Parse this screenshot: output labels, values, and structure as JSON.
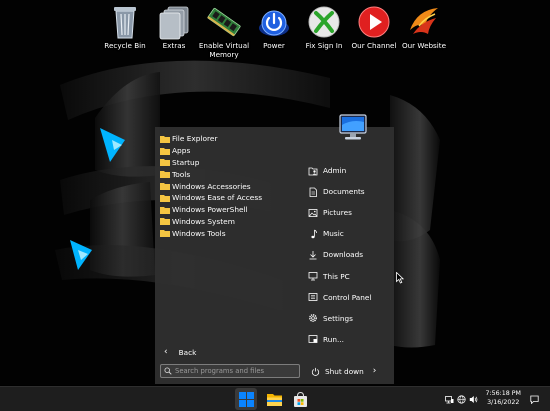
{
  "desktop_icons": [
    {
      "label": "Recycle Bin",
      "icon": "recycle-bin-icon"
    },
    {
      "label": "Extras",
      "icon": "extras-icon"
    },
    {
      "label": "Enable Virtual Memory",
      "icon": "memory-module-icon"
    },
    {
      "label": "Power",
      "icon": "power-icon"
    },
    {
      "label": "Fix Sign In",
      "icon": "xbox-icon"
    },
    {
      "label": "Our Channel",
      "icon": "play-channel-icon"
    },
    {
      "label": "Our Website",
      "icon": "website-logo-icon"
    }
  ],
  "start_menu": {
    "folders": [
      {
        "label": "File Explorer",
        "icon": "folder-icon"
      },
      {
        "label": "Apps",
        "icon": "folder-icon"
      },
      {
        "label": "Startup",
        "icon": "folder-icon"
      },
      {
        "label": "Tools",
        "icon": "folder-icon"
      },
      {
        "label": "Windows Accessories",
        "icon": "folder-icon"
      },
      {
        "label": "Windows Ease of Access",
        "icon": "folder-icon"
      },
      {
        "label": "Windows PowerShell",
        "icon": "folder-icon"
      },
      {
        "label": "Windows System",
        "icon": "folder-icon"
      },
      {
        "label": "Windows Tools",
        "icon": "folder-icon"
      }
    ],
    "user_picture_icon": "monitor-icon",
    "right_items": [
      {
        "label": "Admin",
        "icon": "user-folder-icon"
      },
      {
        "label": "Documents",
        "icon": "document-icon"
      },
      {
        "label": "Pictures",
        "icon": "picture-icon"
      },
      {
        "label": "Music",
        "icon": "music-icon"
      },
      {
        "label": "Downloads",
        "icon": "download-icon"
      },
      {
        "label": "This PC",
        "icon": "computer-icon"
      },
      {
        "label": "Control Panel",
        "icon": "control-panel-icon"
      },
      {
        "label": "Settings",
        "icon": "gear-icon"
      },
      {
        "label": "Run...",
        "icon": "run-icon"
      }
    ],
    "back_label": "Back",
    "search_placeholder": "Search programs and files",
    "shutdown_label": "Shut down"
  },
  "taskbar": {
    "buttons": [
      {
        "name": "start",
        "icon": "windows-logo-icon",
        "active": true
      },
      {
        "name": "file-explorer",
        "icon": "folder-icon"
      },
      {
        "name": "store",
        "icon": "store-bag-icon"
      }
    ],
    "tray_icons": [
      "network-icon",
      "globe-icon",
      "volume-icon"
    ],
    "time": "7:56:18 PM",
    "date": "3/16/2022",
    "notification_icon": "notification-icon"
  },
  "colors": {
    "accent_blue": "#0a84ff",
    "glow_cyan": "#00b4ff",
    "folder_yellow": "#f4c542",
    "menu_background": "#303030",
    "taskbar_background": "#1e1e1e"
  }
}
